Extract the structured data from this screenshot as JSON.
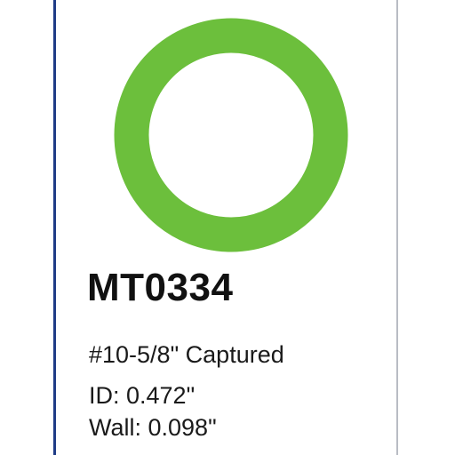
{
  "product": {
    "part_number": "MT0334",
    "description": "#10-5/8\" Captured",
    "inner_diameter": "ID: 0.472\"",
    "wall": "Wall: 0.098\""
  },
  "image": {
    "icon": "o-ring-icon",
    "ring_color": "#6cbf3c"
  },
  "colors": {
    "left_border": "#1f3b86",
    "right_border": "#b9bcc4",
    "text": "#111111"
  }
}
